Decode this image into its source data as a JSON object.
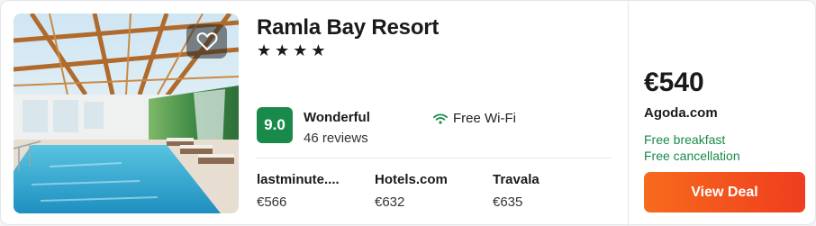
{
  "hotel": {
    "name": "Ramla Bay Resort",
    "stars": 4,
    "star_glyph": "★"
  },
  "rating": {
    "score": "9.0",
    "label": "Wonderful",
    "reviews": "46 reviews",
    "color": "#1a8a4a"
  },
  "amenities": [
    {
      "icon": "wifi-icon",
      "label": "Free Wi-Fi"
    }
  ],
  "providers": [
    {
      "name": "lastminute....",
      "price": "€566"
    },
    {
      "name": "Hotels.com",
      "price": "€632"
    },
    {
      "name": "Travala",
      "price": "€635"
    }
  ],
  "deal": {
    "price": "€540",
    "source": "Agoda.com",
    "perks": [
      "Free breakfast",
      "Free cancellation"
    ],
    "perk_color": "#1a8a4a",
    "button_label": "View Deal",
    "button_color": "#f25a1e"
  },
  "photo": {
    "icon": "heart-icon"
  }
}
